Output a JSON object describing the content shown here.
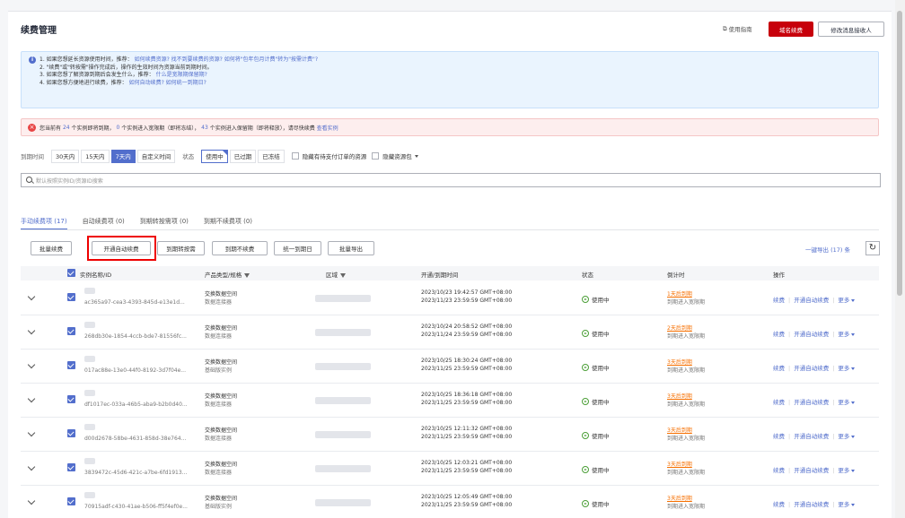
{
  "header": {
    "title": "续费管理",
    "guide_label": "使用指南",
    "renew_domain_label": "域名续费",
    "modify_receiver_label": "修改消息接收人"
  },
  "info": {
    "line1_a": "1. 如果您想延长资源使用时间，推荐：",
    "line1_link1": "如何续费资源?",
    "line1_link2": "找不到要续费的资源?",
    "line1_link3": "如何将\"包年包月计费\"转为\"按需计费\"?",
    "line2": "2. \"续费\"或\"转按需\"操作完成后，操作的生效时间为资源当前到期时间。",
    "line3_a": "3. 如果您想了解资源到期后会发生什么，推荐：",
    "line3_link": "什么是宽限期保留期?",
    "line4_a": "4. 如果您想方便地进行续费，推荐：",
    "line4_link": "如何自动续费?",
    "line4_link2": "如何统一到期日?"
  },
  "warning": {
    "pre": "您当前有",
    "n1": "24",
    "t1": "个实例即将到期，",
    "n2": "0",
    "t2": "个实例进入宽限期（即将冻结），",
    "n3": "43",
    "t3": "个实例进入保留期（即将释放），请尽快续费",
    "link": "查看实例"
  },
  "filters": {
    "expire_label": "到期时间",
    "expire_options": [
      "30天内",
      "15天内",
      "7天内",
      "自定义时间"
    ],
    "status_label": "状态",
    "status_options": [
      "使用中",
      "已过期",
      "已冻结"
    ],
    "hide_pending": "隐藏有待支付订单的资源",
    "hide_package": "隐藏资源包"
  },
  "search": {
    "placeholder": "默认按照实例ID/资源ID搜索"
  },
  "tabs": [
    "手动续费项 (17)",
    "自动续费项 (0)",
    "到期转按需项 (0)",
    "到期不续费项 (0)"
  ],
  "toolbar": {
    "batch_renew": "批量续费",
    "auto_renew": "开通自动续费",
    "to_ondemand": "到期转按需",
    "no_renew": "到期不续费",
    "unify_date": "统一到期日",
    "batch_export": "批量导出",
    "export_all": "一键导出 (17) 条"
  },
  "table": {
    "headers": {
      "name": "实例名称/ID",
      "product": "产品类型/规格",
      "region": "区域",
      "time": "开通/到期时间",
      "status": "状态",
      "countdown": "倒计时",
      "ops": "操作"
    },
    "rows": [
      {
        "id": "ac365a97-cea3-4393-845d-e13e1d...",
        "type": "交换数据空间",
        "spec": "数据连接器",
        "open": "2023/10/23 19:42:57 GMT+08:00",
        "expire": "2023/11/23 23:59:59 GMT+08:00",
        "status": "使用中",
        "countdown": "1天后到期",
        "note": "到期进入宽限期"
      },
      {
        "id": "268db30e-1854-4ccb-bde7-81556fc...",
        "type": "交换数据空间",
        "spec": "数据连接器",
        "open": "2023/10/24 20:58:52 GMT+08:00",
        "expire": "2023/11/24 23:59:59 GMT+08:00",
        "status": "使用中",
        "countdown": "2天后到期",
        "note": "到期进入宽限期"
      },
      {
        "id": "017ac88e-13e0-44f0-8192-3d7f04e...",
        "type": "交换数据空间",
        "spec": "基础版实例",
        "open": "2023/10/25 18:30:24 GMT+08:00",
        "expire": "2023/11/25 23:59:59 GMT+08:00",
        "status": "使用中",
        "countdown": "3天后到期",
        "note": "到期进入宽限期"
      },
      {
        "id": "df1017ec-033a-46b5-aba9-b2b0d40...",
        "type": "交换数据空间",
        "spec": "数据连接器",
        "open": "2023/10/25 18:36:18 GMT+08:00",
        "expire": "2023/11/25 23:59:59 GMT+08:00",
        "status": "使用中",
        "countdown": "3天后到期",
        "note": "到期进入宽限期"
      },
      {
        "id": "d00d2678-58be-4631-858d-38e764...",
        "type": "交换数据空间",
        "spec": "数据连接器",
        "open": "2023/10/25 12:11:32 GMT+08:00",
        "expire": "2023/11/25 23:59:59 GMT+08:00",
        "status": "使用中",
        "countdown": "3天后到期",
        "note": "到期进入宽限期"
      },
      {
        "id": "3839472c-45d6-421c-a7be-6fd1913...",
        "type": "交换数据空间",
        "spec": "数据连接器",
        "open": "2023/10/25 12:03:21 GMT+08:00",
        "expire": "2023/11/25 23:59:59 GMT+08:00",
        "status": "使用中",
        "countdown": "3天后到期",
        "note": "到期进入宽限期"
      },
      {
        "id": "70915adf-c430-41ae-b506-ff5f4ef0e...",
        "type": "交换数据空间",
        "spec": "基础版实例",
        "open": "2023/10/25 12:05:49 GMT+08:00",
        "expire": "2023/11/25 23:59:59 GMT+08:00",
        "status": "使用中",
        "countdown": "3天后到期",
        "note": "到期进入宽限期"
      }
    ],
    "ops": {
      "renew": "续费",
      "auto": "开通自动续费",
      "more": "更多"
    }
  }
}
